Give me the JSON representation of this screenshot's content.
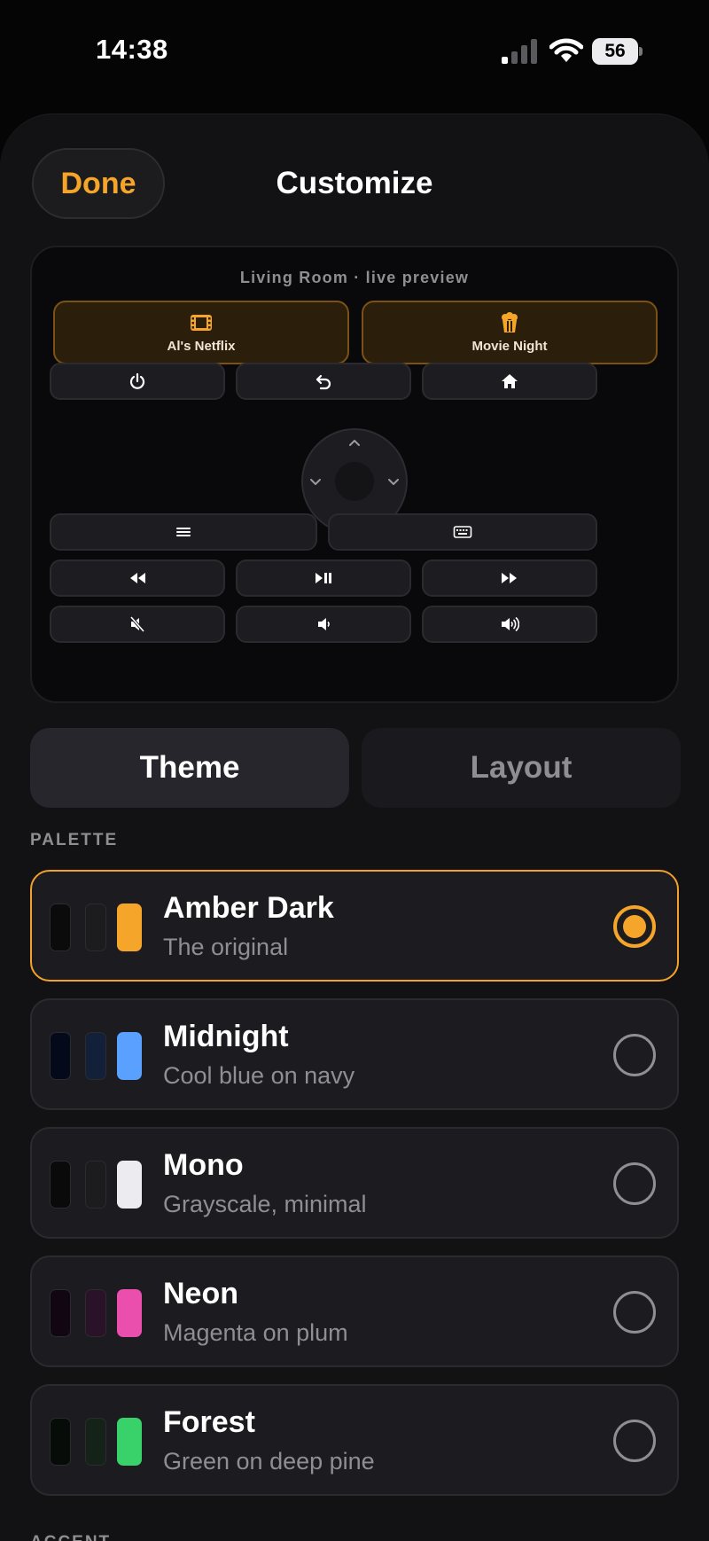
{
  "status": {
    "time": "14:38",
    "battery": "56"
  },
  "header": {
    "done_label": "Done",
    "title": "Customize"
  },
  "preview": {
    "caption": "Living  Room · live preview",
    "macros": [
      {
        "label": "Al's Netflix",
        "icon": "film-icon"
      },
      {
        "label": "Movie Night",
        "icon": "popcorn-icon"
      }
    ],
    "buttons": [
      "power-icon",
      "back-icon",
      "home-icon",
      "dpad-up-icon",
      "dpad-left-icon",
      "dpad-right-icon",
      "dpad-down-icon",
      "menu-icon",
      "keyboard-icon",
      "rewind-icon",
      "play-pause-icon",
      "fast-forward-icon",
      "mute-icon",
      "volume-down-icon",
      "volume-up-icon"
    ]
  },
  "tabs": [
    {
      "label": "Theme",
      "selected": true
    },
    {
      "label": "Layout",
      "selected": false
    }
  ],
  "palette_section": {
    "label": "PALETTE"
  },
  "palettes": [
    {
      "name": "Amber Dark",
      "desc": "The original",
      "selected": true,
      "colors": [
        "#0b0b0c",
        "#1c1c1f",
        "#f4a52a"
      ]
    },
    {
      "name": "Midnight",
      "desc": "Cool blue on navy",
      "selected": false,
      "colors": [
        "#050a1a",
        "#12203a",
        "#5aa0ff"
      ]
    },
    {
      "name": "Mono",
      "desc": "Grayscale, minimal",
      "selected": false,
      "colors": [
        "#0a0a0a",
        "#1c1c1e",
        "#ebebf0"
      ]
    },
    {
      "name": "Neon",
      "desc": "Magenta on plum",
      "selected": false,
      "colors": [
        "#120612",
        "#2a1228",
        "#ea4fae"
      ]
    },
    {
      "name": "Forest",
      "desc": "Green on deep pine",
      "selected": false,
      "colors": [
        "#060d08",
        "#142218",
        "#38d16a"
      ]
    }
  ],
  "accent_section": {
    "label": "ACCENT"
  },
  "theme": {
    "accent": "#f4a52a",
    "background": "#121215",
    "card": "#1c1c20"
  }
}
